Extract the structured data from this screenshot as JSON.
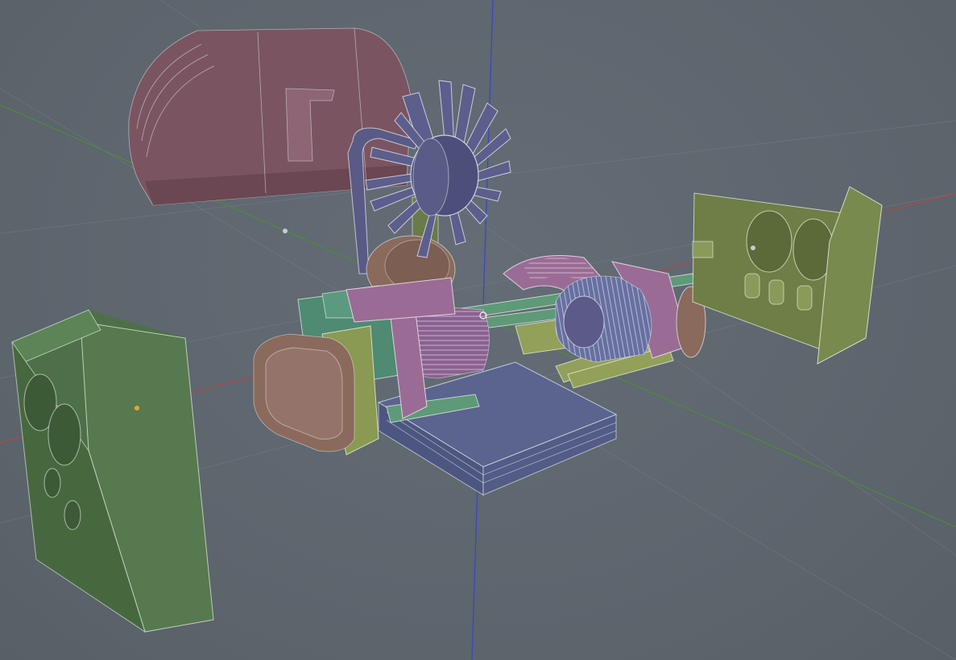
{
  "viewport": {
    "background": "#5f6770",
    "axes": {
      "x_color": "#b04848",
      "y_color": "#4e8a3c",
      "z_color": "#3a44c8"
    },
    "origin_color": "#f2a12c"
  },
  "objects": [
    {
      "name": "rear-cover-piece",
      "color": "#7a5561"
    },
    {
      "name": "cooling-fan",
      "color": "#4d4f7a"
    },
    {
      "name": "fan-belt",
      "color": "#5a5a86"
    },
    {
      "name": "engine-block",
      "color": "#8f5f80"
    },
    {
      "name": "exhaust-cover",
      "color": "#8a6a5c"
    },
    {
      "name": "oil-pan",
      "color": "#56608a"
    },
    {
      "name": "left-gauge-panel",
      "color": "#4e7048"
    },
    {
      "name": "right-gauge-panel",
      "color": "#788a4e"
    }
  ]
}
